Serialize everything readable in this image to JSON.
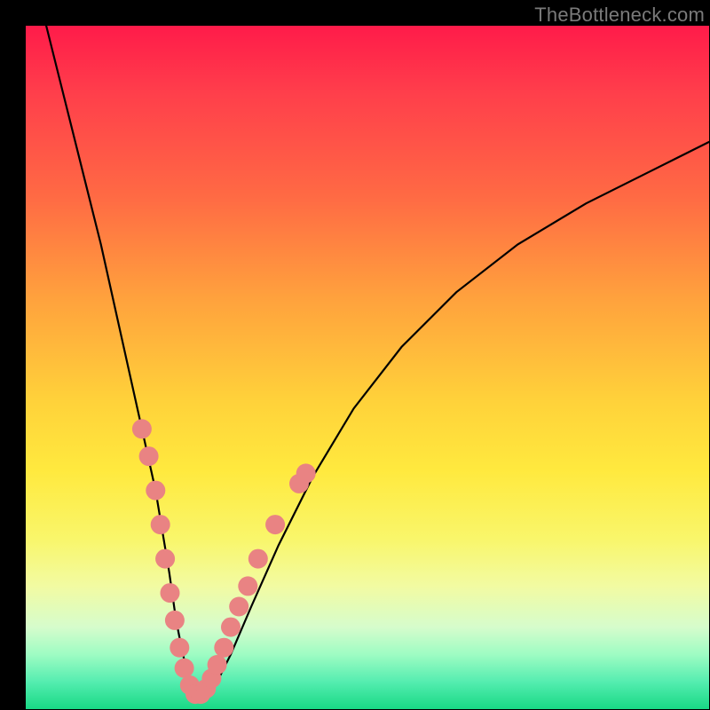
{
  "watermark": "TheBottleneck.com",
  "chart_data": {
    "type": "line",
    "title": "",
    "xlabel": "",
    "ylabel": "",
    "xlim": [
      0,
      100
    ],
    "ylim": [
      0,
      100
    ],
    "series": [
      {
        "name": "bottleneck-curve",
        "x": [
          3,
          5,
          7,
          9,
          11,
          13,
          15,
          17,
          19,
          21,
          22,
          23,
          24,
          25,
          26,
          28,
          30,
          33,
          37,
          42,
          48,
          55,
          63,
          72,
          82,
          92,
          100
        ],
        "y": [
          100,
          92,
          84,
          76,
          68,
          59,
          50,
          41,
          32,
          20,
          13,
          8,
          4,
          2,
          2,
          4,
          8,
          15,
          24,
          34,
          44,
          53,
          61,
          68,
          74,
          79,
          83
        ]
      }
    ],
    "highlight_points": {
      "name": "pink-dots",
      "color": "#e98383",
      "points": [
        {
          "x": 17,
          "y": 41
        },
        {
          "x": 18,
          "y": 37
        },
        {
          "x": 19,
          "y": 32
        },
        {
          "x": 19.7,
          "y": 27
        },
        {
          "x": 20.4,
          "y": 22
        },
        {
          "x": 21.1,
          "y": 17
        },
        {
          "x": 21.8,
          "y": 13
        },
        {
          "x": 22.5,
          "y": 9
        },
        {
          "x": 23.2,
          "y": 6
        },
        {
          "x": 24,
          "y": 3.5
        },
        {
          "x": 24.8,
          "y": 2.2
        },
        {
          "x": 25.6,
          "y": 2.2
        },
        {
          "x": 26.4,
          "y": 3
        },
        {
          "x": 27.2,
          "y": 4.5
        },
        {
          "x": 28,
          "y": 6.5
        },
        {
          "x": 29,
          "y": 9
        },
        {
          "x": 30,
          "y": 12
        },
        {
          "x": 31.2,
          "y": 15
        },
        {
          "x": 32.5,
          "y": 18
        },
        {
          "x": 34,
          "y": 22
        },
        {
          "x": 36.5,
          "y": 27
        },
        {
          "x": 40,
          "y": 33
        },
        {
          "x": 41,
          "y": 34.5
        }
      ]
    }
  }
}
